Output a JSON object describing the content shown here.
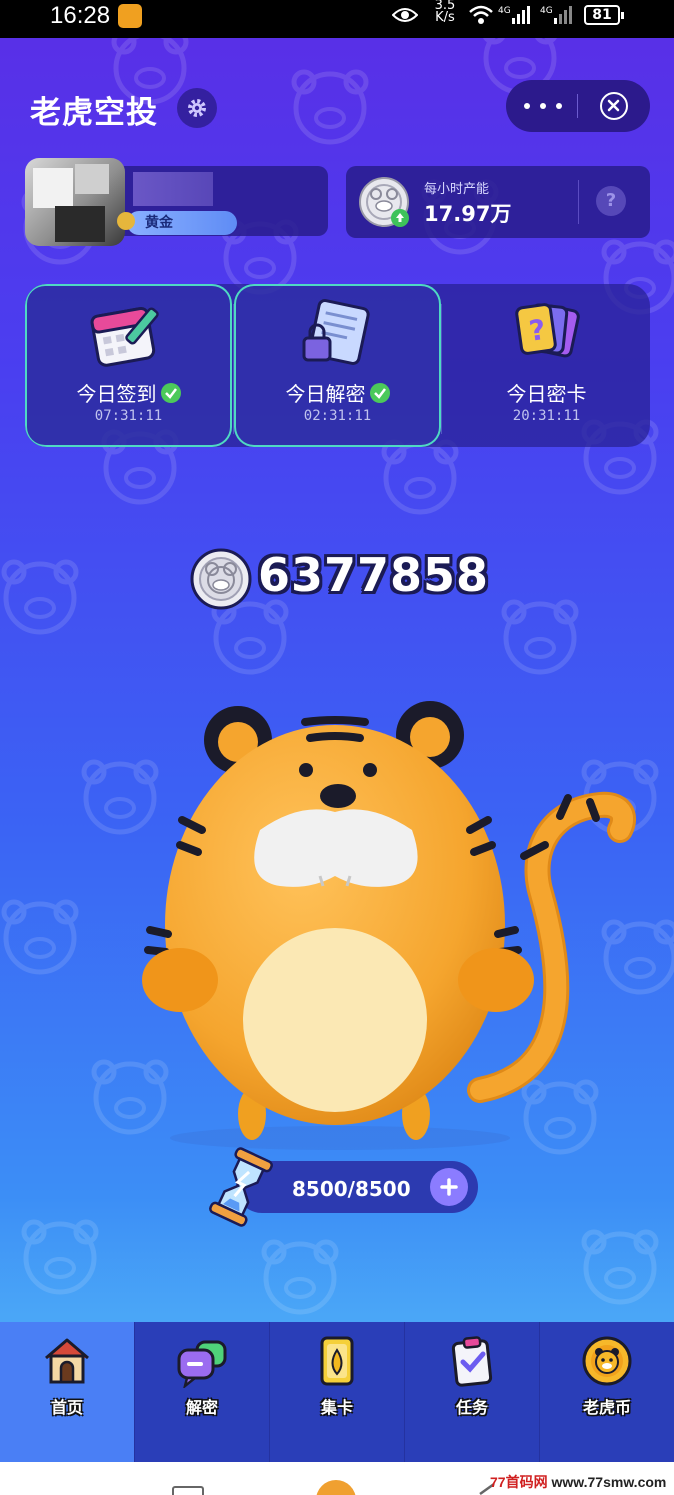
{
  "status_bar": {
    "time": "16:28",
    "speed": "3.5\nK/s",
    "network1": "4G",
    "network2": "4G",
    "battery": "81"
  },
  "header": {
    "title": "老虎空投"
  },
  "profile": {
    "level": "黄金"
  },
  "production": {
    "label": "每小时产能",
    "value": "17.97万",
    "help": "?"
  },
  "daily": [
    {
      "label": "今日签到",
      "time": "07:31:11",
      "checked": true
    },
    {
      "label": "今日解密",
      "time": "02:31:11",
      "checked": true
    },
    {
      "label": "今日密卡",
      "time": "20:31:11",
      "checked": false
    }
  ],
  "balance": "6377858",
  "energy": "8500/8500",
  "tabs": [
    {
      "label": "首页",
      "icon": "house-icon"
    },
    {
      "label": "解密",
      "icon": "chat-bubble-icon"
    },
    {
      "label": "集卡",
      "icon": "card-icon"
    },
    {
      "label": "任务",
      "icon": "clipboard-check-icon"
    },
    {
      "label": "老虎币",
      "icon": "tiger-coin-icon"
    }
  ],
  "footer": {
    "site_prefix": "77首码网",
    "site_url": "www.77smw.com"
  },
  "colors": {
    "bg_top": "#5a2ee6",
    "bg_bottom": "#4aa6f7",
    "panel": "#2c1a8c",
    "check_green": "#4cc95a",
    "tabbar": "#2a3eb8",
    "tab_active": "#4a7ff5"
  }
}
